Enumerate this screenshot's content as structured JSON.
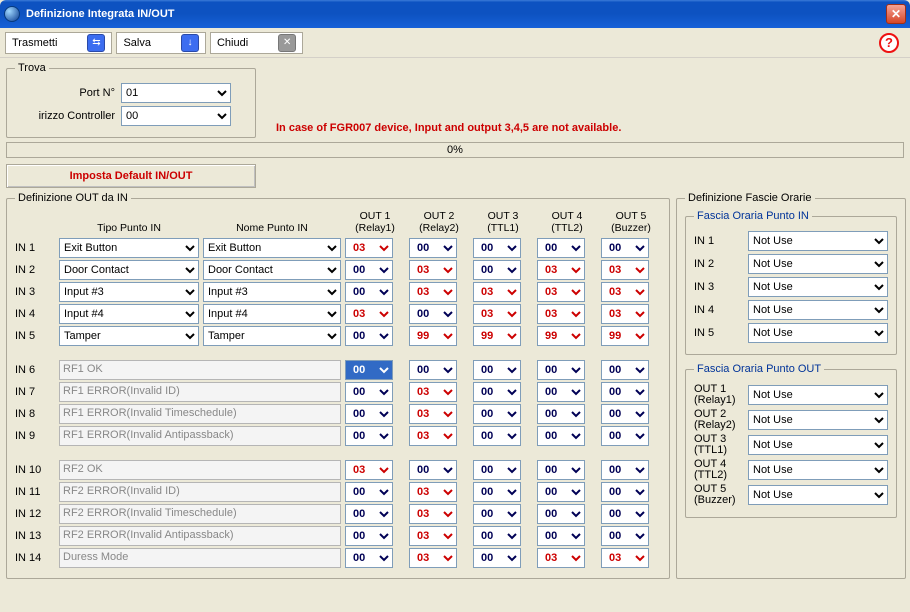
{
  "window": {
    "title": "Definizione Integrata IN/OUT"
  },
  "toolbar": {
    "transmit": "Trasmetti",
    "save": "Salva",
    "close": "Chiudi"
  },
  "trova": {
    "legend": "Trova",
    "port_label": "Port N°",
    "port_value": "01",
    "ctrl_label": "irizzo Controller",
    "ctrl_value": "00"
  },
  "warning": "In case of FGR007 device, Input and output 3,4,5 are not available.",
  "progress_text": "0%",
  "default_button": "Imposta Default IN/OUT",
  "definizione": {
    "legend": "Definizione OUT da IN",
    "header_tipo": "Tipo Punto IN",
    "header_nome": "Nome Punto IN",
    "out_headers": [
      {
        "l1": "OUT 1",
        "l2": "(Relay1)"
      },
      {
        "l1": "OUT 2",
        "l2": "(Relay2)"
      },
      {
        "l1": "OUT 3",
        "l2": "(TTL1)"
      },
      {
        "l1": "OUT 4",
        "l2": "(TTL2)"
      },
      {
        "l1": "OUT 5",
        "l2": "(Buzzer)"
      }
    ],
    "rows": [
      {
        "label": "IN 1",
        "type": "Exit Button",
        "name": "Exit Button",
        "ro": false,
        "vals": [
          {
            "v": "03",
            "c": "red"
          },
          {
            "v": "00",
            "c": "blue"
          },
          {
            "v": "00",
            "c": "blue"
          },
          {
            "v": "00",
            "c": "blue"
          },
          {
            "v": "00",
            "c": "blue"
          }
        ]
      },
      {
        "label": "IN 2",
        "type": "Door Contact",
        "name": "Door Contact",
        "ro": false,
        "vals": [
          {
            "v": "00",
            "c": "blue"
          },
          {
            "v": "03",
            "c": "red"
          },
          {
            "v": "00",
            "c": "blue"
          },
          {
            "v": "03",
            "c": "red"
          },
          {
            "v": "03",
            "c": "red"
          }
        ]
      },
      {
        "label": "IN 3",
        "type": "Input #3",
        "name": "Input #3",
        "ro": false,
        "vals": [
          {
            "v": "00",
            "c": "blue"
          },
          {
            "v": "03",
            "c": "red"
          },
          {
            "v": "03",
            "c": "red"
          },
          {
            "v": "03",
            "c": "red"
          },
          {
            "v": "03",
            "c": "red"
          }
        ]
      },
      {
        "label": "IN 4",
        "type": "Input #4",
        "name": "Input #4",
        "ro": false,
        "vals": [
          {
            "v": "03",
            "c": "red"
          },
          {
            "v": "00",
            "c": "blue"
          },
          {
            "v": "03",
            "c": "red"
          },
          {
            "v": "03",
            "c": "red"
          },
          {
            "v": "03",
            "c": "red"
          }
        ]
      },
      {
        "label": "IN 5",
        "type": "Tamper",
        "name": "Tamper",
        "ro": false,
        "vals": [
          {
            "v": "00",
            "c": "blue"
          },
          {
            "v": "99",
            "c": "red"
          },
          {
            "v": "99",
            "c": "red"
          },
          {
            "v": "99",
            "c": "red"
          },
          {
            "v": "99",
            "c": "red"
          }
        ]
      },
      {
        "gap": true
      },
      {
        "label": "IN 6",
        "type": "",
        "name": "RF1 OK",
        "ro": true,
        "vals": [
          {
            "v": "00",
            "c": "sel"
          },
          {
            "v": "00",
            "c": "blue"
          },
          {
            "v": "00",
            "c": "blue"
          },
          {
            "v": "00",
            "c": "blue"
          },
          {
            "v": "00",
            "c": "blue"
          }
        ]
      },
      {
        "label": "IN 7",
        "type": "",
        "name": "RF1 ERROR(Invalid ID)",
        "ro": true,
        "vals": [
          {
            "v": "00",
            "c": "blue"
          },
          {
            "v": "03",
            "c": "red"
          },
          {
            "v": "00",
            "c": "blue"
          },
          {
            "v": "00",
            "c": "blue"
          },
          {
            "v": "00",
            "c": "blue"
          }
        ]
      },
      {
        "label": "IN 8",
        "type": "",
        "name": "RF1 ERROR(Invalid Timeschedule)",
        "ro": true,
        "vals": [
          {
            "v": "00",
            "c": "blue"
          },
          {
            "v": "03",
            "c": "red"
          },
          {
            "v": "00",
            "c": "blue"
          },
          {
            "v": "00",
            "c": "blue"
          },
          {
            "v": "00",
            "c": "blue"
          }
        ]
      },
      {
        "label": "IN 9",
        "type": "",
        "name": "RF1 ERROR(Invalid Antipassback)",
        "ro": true,
        "vals": [
          {
            "v": "00",
            "c": "blue"
          },
          {
            "v": "03",
            "c": "red"
          },
          {
            "v": "00",
            "c": "blue"
          },
          {
            "v": "00",
            "c": "blue"
          },
          {
            "v": "00",
            "c": "blue"
          }
        ]
      },
      {
        "gap": true
      },
      {
        "label": "IN 10",
        "type": "",
        "name": "RF2 OK",
        "ro": true,
        "vals": [
          {
            "v": "03",
            "c": "red"
          },
          {
            "v": "00",
            "c": "blue"
          },
          {
            "v": "00",
            "c": "blue"
          },
          {
            "v": "00",
            "c": "blue"
          },
          {
            "v": "00",
            "c": "blue"
          }
        ]
      },
      {
        "label": "IN 11",
        "type": "",
        "name": "RF2 ERROR(Invalid ID)",
        "ro": true,
        "vals": [
          {
            "v": "00",
            "c": "blue"
          },
          {
            "v": "03",
            "c": "red"
          },
          {
            "v": "00",
            "c": "blue"
          },
          {
            "v": "00",
            "c": "blue"
          },
          {
            "v": "00",
            "c": "blue"
          }
        ]
      },
      {
        "label": "IN 12",
        "type": "",
        "name": "RF2 ERROR(Invalid Timeschedule)",
        "ro": true,
        "vals": [
          {
            "v": "00",
            "c": "blue"
          },
          {
            "v": "03",
            "c": "red"
          },
          {
            "v": "00",
            "c": "blue"
          },
          {
            "v": "00",
            "c": "blue"
          },
          {
            "v": "00",
            "c": "blue"
          }
        ]
      },
      {
        "label": "IN 13",
        "type": "",
        "name": "RF2 ERROR(Invalid Antipassback)",
        "ro": true,
        "vals": [
          {
            "v": "00",
            "c": "blue"
          },
          {
            "v": "03",
            "c": "red"
          },
          {
            "v": "00",
            "c": "blue"
          },
          {
            "v": "00",
            "c": "blue"
          },
          {
            "v": "00",
            "c": "blue"
          }
        ]
      },
      {
        "label": "IN 14",
        "type": "",
        "name": "Duress Mode",
        "ro": true,
        "vals": [
          {
            "v": "00",
            "c": "blue"
          },
          {
            "v": "03",
            "c": "red"
          },
          {
            "v": "00",
            "c": "blue"
          },
          {
            "v": "03",
            "c": "red"
          },
          {
            "v": "03",
            "c": "red"
          }
        ]
      }
    ]
  },
  "fascie": {
    "legend": "Definizione Fascie Orarie",
    "in_legend": "Fascia Oraria Punto IN",
    "out_legend": "Fascia Oraria Punto OUT",
    "not_use": "Not Use",
    "in_rows": [
      "IN 1",
      "IN 2",
      "IN 3",
      "IN 4",
      "IN 5"
    ],
    "out_rows": [
      {
        "l1": "OUT 1",
        "l2": "(Relay1)"
      },
      {
        "l1": "OUT 2",
        "l2": "(Relay2)"
      },
      {
        "l1": "OUT 3",
        "l2": "(TTL1)"
      },
      {
        "l1": "OUT 4",
        "l2": "(TTL2)"
      },
      {
        "l1": "OUT 5",
        "l2": "(Buzzer)"
      }
    ]
  }
}
